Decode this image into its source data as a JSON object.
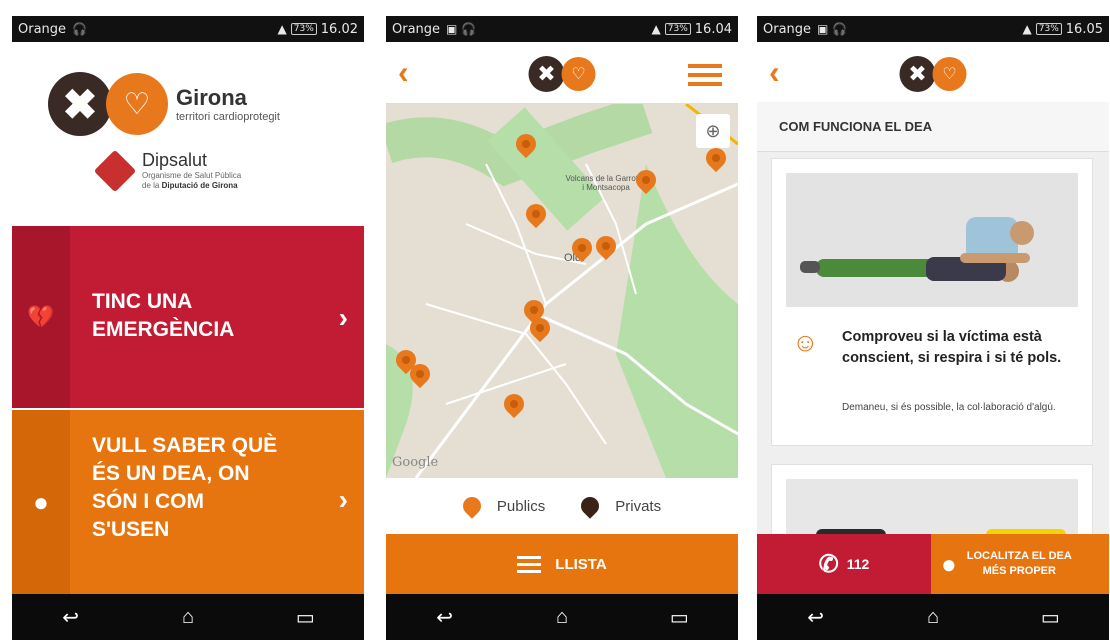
{
  "status": {
    "carrier": "Orange",
    "times": [
      "16.02",
      "16.04",
      "16.05"
    ],
    "battery": "73%"
  },
  "phone1": {
    "logo_city": "Girona",
    "logo_sub": "territori cardioprotegit",
    "org_name": "Dipsalut",
    "org_line1": "Organisme de Salut Pública",
    "org_line2_prefix": "de la",
    "org_line2_bold": "Diputació de Girona",
    "emergency_label_1": "TINC UNA",
    "emergency_label_2": "EMERGÈNCIA",
    "info_label_1": "VULL SABER QUÈ",
    "info_label_2": "ÉS UN DEA, ON",
    "info_label_3": "SÓN I COM",
    "info_label_4": "S'USEN"
  },
  "phone2": {
    "map_label_1": "Volcans de la Garrotxa",
    "map_label_2": "i Montsacopa",
    "map_city": "Olot",
    "google": "Google",
    "legend_public": "Publics",
    "legend_private": "Privats",
    "list_button": "LLISTA",
    "colors": {
      "public": "#e8781c",
      "private": "#3a2316"
    }
  },
  "phone3": {
    "section_title": "COM FUNCIONA EL DEA",
    "step_title": "Comproveu si la víctima està conscient, si respira i si té pols.",
    "step_desc": "Demaneu, si és possible, la col·laboració d'algú.",
    "call_label": "112",
    "locate_label_1": "LOCALITZA EL DEA",
    "locate_label_2": "MÉS PROPER"
  },
  "icons": {
    "back": "‹",
    "chevron": "›",
    "home": "⌂",
    "recent": "▭",
    "navback": "↩"
  }
}
